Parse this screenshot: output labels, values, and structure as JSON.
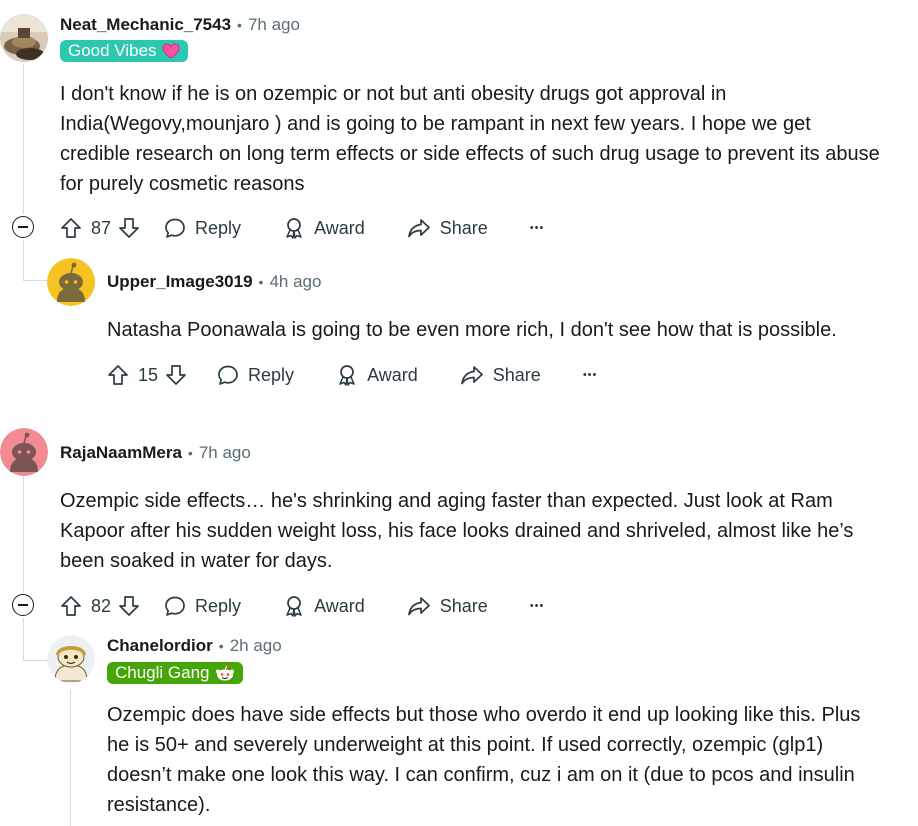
{
  "comments": [
    {
      "username": "Neat_Mechanic_7543",
      "separator": "•",
      "time": "7h ago",
      "flair": {
        "text": "Good Vibes",
        "bg": "#2bc7b0",
        "icon": "heart-icon"
      },
      "body": [
        "I don't know if he is on ozempic or not but anti obesity drugs got approval in",
        "India(Wegovy,mounjaro ) and is going to be rampant in next few years. I hope we get",
        "credible research on long term effects or side effects of such drug usage to prevent its abuse",
        "for purely cosmetic reasons"
      ],
      "votes": "87"
    },
    {
      "username": "Upper_Image3019",
      "separator": "•",
      "time": "4h ago",
      "body": [
        "Natasha Poonawala is going to be even more rich, I don't see how that is possible."
      ],
      "votes": "15"
    },
    {
      "username": "RajaNaamMera",
      "separator": "•",
      "time": "7h ago",
      "body": [
        "Ozempic side effects… he's shrinking and aging faster than expected. Just look at Ram",
        "Kapoor after his sudden weight loss, his face looks drained and shriveled, almost like he’s",
        "been soaked in water for days."
      ],
      "votes": "82"
    },
    {
      "username": "Chanelordior",
      "separator": "•",
      "time": "2h ago",
      "flair": {
        "text": "Chugli Gang",
        "bg": "#46a508",
        "icon": "snoo-icon"
      },
      "body": [
        "Ozempic does have side effects but those who overdo it end up looking like this. Plus",
        "he is 50+ and severely underweight at this point. If used correctly, ozempic (glp1)",
        "doesn’t make one look this way. I can confirm, cuz i am on it (due to pcos and insulin",
        "resistance)."
      ]
    }
  ],
  "actions": {
    "reply": "Reply",
    "award": "Award",
    "share": "Share",
    "more": "•••"
  },
  "colors": {
    "text": "#1a1a1b",
    "meta": "#576f76",
    "thread_line": "#d7dadc",
    "avatar_yellow": "#f5c422",
    "avatar_pink": "#f28b91"
  }
}
